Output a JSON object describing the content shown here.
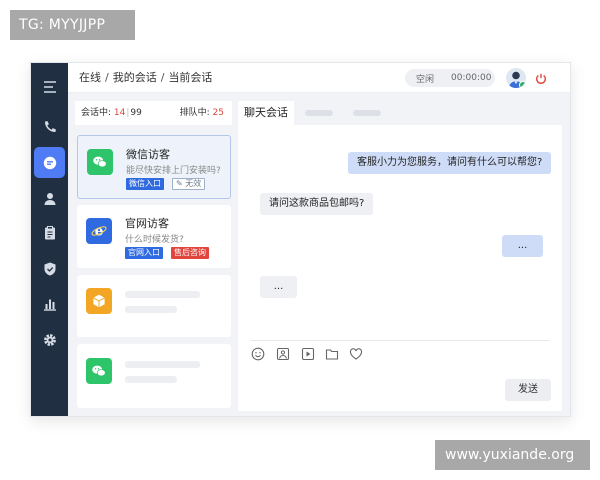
{
  "watermarks": {
    "top": "TG: MYYJJPP",
    "bottom": "www.yuxiande.org"
  },
  "sidebar": {
    "items": [
      {
        "icon": "menu-icon"
      },
      {
        "icon": "phone-icon"
      },
      {
        "icon": "chat-icon",
        "active": true
      },
      {
        "icon": "user-icon"
      },
      {
        "icon": "clipboard-icon"
      },
      {
        "icon": "shield-icon"
      },
      {
        "icon": "bar-chart-icon"
      },
      {
        "icon": "gear-icon"
      }
    ]
  },
  "header": {
    "breadcrumb": [
      "在线",
      "我的会话",
      "当前会话"
    ],
    "breadcrumb_sep": "/",
    "status": "空闲",
    "timer": "00:00:00"
  },
  "counts": {
    "in_session_label": "会话中:",
    "in_session": "14",
    "sep": "|",
    "capacity": "99",
    "queue_label": "排队中:",
    "queue": "25"
  },
  "conversations": [
    {
      "name": "微信访客",
      "message": "能尽快安排上门安装吗?",
      "tags": [
        "微信入口",
        "无效"
      ],
      "icon": "wechat-icon",
      "selected": true
    },
    {
      "name": "官网访客",
      "message": "什么时候发货?",
      "tags": [
        "官网入口",
        "售后咨询"
      ],
      "icon": "ie-browser-icon"
    },
    {
      "icon": "package-icon",
      "placeholder": true
    },
    {
      "icon": "wechat-icon",
      "placeholder": true
    }
  ],
  "chat": {
    "tab_label": "聊天会话",
    "messages": [
      {
        "from": "agent",
        "text": "客服小力为您服务，请问有什么可以帮您?"
      },
      {
        "from": "visitor",
        "text": "请问这款商品包邮吗?"
      },
      {
        "from": "agent",
        "text": "..."
      },
      {
        "from": "visitor",
        "text": "..."
      }
    ],
    "tools": [
      "emoji-icon",
      "image-icon",
      "video-icon",
      "folder-icon",
      "heart-icon"
    ],
    "send_label": "发送"
  },
  "colors": {
    "sidebar_bg": "#212f42",
    "accent": "#4f7cf5",
    "agent_bubble": "#cfdcf7",
    "red_count": "#e0463e",
    "tag_blue": "#2f6ae0",
    "tag_red": "#e0463e",
    "wechat_green": "#2ec46a",
    "ie_blue": "#2f6ae0",
    "package_orange": "#f2a623"
  }
}
